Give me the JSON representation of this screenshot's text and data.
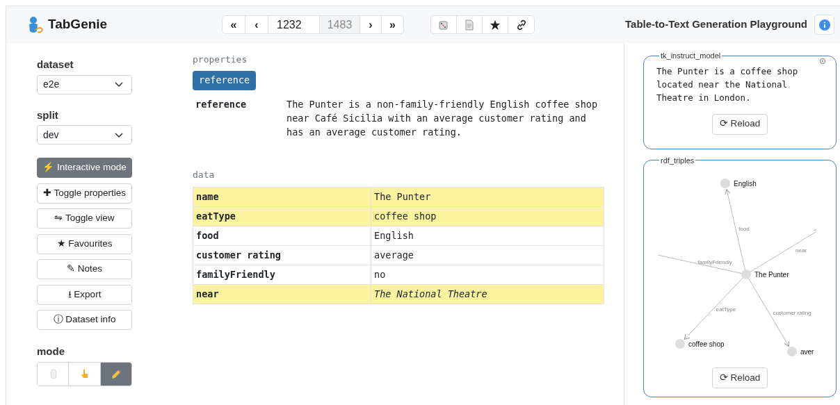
{
  "header": {
    "app_name": "TabGenie",
    "title": "Table-to-Text Generation Playground"
  },
  "pager": {
    "first": "«",
    "prev": "‹",
    "current": "1232",
    "total": "1483",
    "next": "›",
    "last": "»"
  },
  "sidebar": {
    "dataset": {
      "label": "dataset",
      "value": "e2e"
    },
    "split": {
      "label": "split",
      "value": "dev"
    },
    "buttons": [
      {
        "label": "Interactive mode",
        "icon": "⚡",
        "selected": true
      },
      {
        "label": "Toggle properties",
        "icon": "✚",
        "selected": false
      },
      {
        "label": "Toggle view",
        "icon": "⇋",
        "selected": false
      },
      {
        "label": "Favourites",
        "icon": "★",
        "selected": false
      },
      {
        "label": "Notes",
        "icon": "✎",
        "selected": false
      },
      {
        "label": "Export",
        "icon": "⭳",
        "selected": false
      },
      {
        "label": "Dataset info",
        "icon": "ⓘ",
        "selected": false
      }
    ],
    "mode": {
      "label": "mode",
      "options": [
        {
          "kind": "mouse",
          "selected": false
        },
        {
          "kind": "hand",
          "selected": false
        },
        {
          "kind": "pencil",
          "selected": true
        }
      ]
    }
  },
  "properties": {
    "heading": "properties",
    "tabs": [
      {
        "label": "reference",
        "selected": true
      }
    ],
    "rows": [
      {
        "key": "reference",
        "value": "The Punter is a non-family-friendly English coffee shop near Café Sicilia with an average customer rating and has an average customer rating."
      }
    ]
  },
  "data": {
    "heading": "data",
    "rows": [
      {
        "key": "name",
        "value": "The Punter",
        "highlighted": true,
        "italic": false
      },
      {
        "key": "eatType",
        "value": "coffee shop",
        "highlighted": true,
        "italic": false
      },
      {
        "key": "food",
        "value": "English",
        "highlighted": false,
        "italic": false
      },
      {
        "key": "customer rating",
        "value": "average",
        "highlighted": false,
        "italic": false
      },
      {
        "key": "familyFriendly",
        "value": "no",
        "highlighted": false,
        "italic": false
      },
      {
        "key": "near",
        "value": "The National Theatre",
        "highlighted": true,
        "italic": true
      }
    ]
  },
  "panels": [
    {
      "kind": "text",
      "title": "tk_instruct_model",
      "text": "The Punter is a coffee shop located near the National Theatre in London.",
      "button": "⟳ Reload"
    },
    {
      "kind": "graph",
      "title": "rdf_triples",
      "nodes": [
        "English",
        "The Punter",
        "coffee shop",
        "aver"
      ],
      "edges": [
        {
          "label": "food"
        },
        {
          "label": "near"
        },
        {
          "label": "familyFriendly"
        },
        {
          "label": "eatType"
        },
        {
          "label": "customer rating"
        }
      ],
      "button": "⟳ Reload"
    }
  ]
}
